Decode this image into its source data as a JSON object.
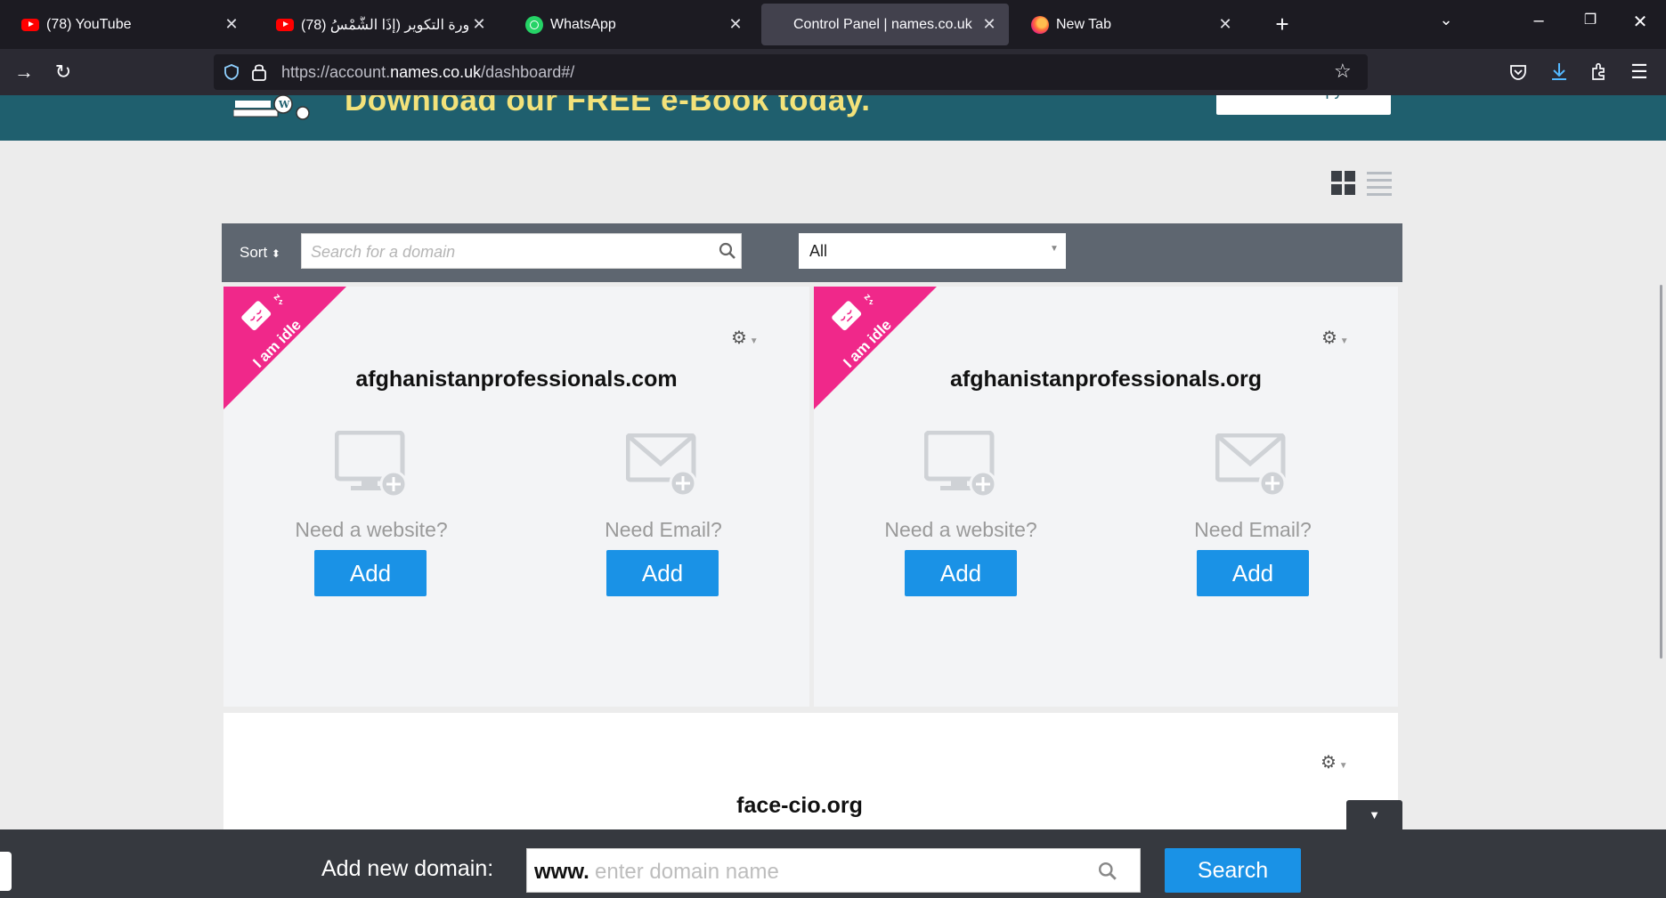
{
  "browser": {
    "tabs": [
      {
        "title": "(78) YouTube",
        "icon": "youtube-icon"
      },
      {
        "title": "(78) سورة التكوير (إِذَا الشَّمْسُ ﴾",
        "icon": "youtube-icon"
      },
      {
        "title": "WhatsApp",
        "icon": "whatsapp-icon"
      },
      {
        "title": "Control Panel | names.co.uk",
        "icon": "none",
        "active": true
      },
      {
        "title": "New Tab",
        "icon": "firefox-icon"
      }
    ],
    "url": "https://account.names.co.uk/dashboard#/",
    "url_parts": {
      "prefix": "https://account.",
      "domain": "names.co.uk",
      "suffix": "/dashboard#/"
    }
  },
  "banner": {
    "text": "Download our FREE e-Book today.",
    "button_label": "Get a copy"
  },
  "toolbar": {
    "sort_label": "Sort",
    "search_placeholder": "Search for a domain",
    "filter_value": "All"
  },
  "cards": [
    {
      "domain": "afghanistanprofessionals.com",
      "ribbon_text": "I am idle",
      "website_prompt": "Need a website?",
      "email_prompt": "Need Email?",
      "add_label": "Add"
    },
    {
      "domain": "afghanistanprofessionals.org",
      "ribbon_text": "I am idle",
      "website_prompt": "Need a website?",
      "email_prompt": "Need Email?",
      "add_label": "Add"
    },
    {
      "domain": "face-cio.org"
    }
  ],
  "bottom_bar": {
    "label": "Add new domain:",
    "www": "www.",
    "placeholder": "enter domain name",
    "search_label": "Search",
    "toggle": "▼"
  },
  "colors": {
    "accent": "#1a92e6",
    "ribbon": "#f0288a",
    "banner_bg": "#1f5f6e",
    "toolbar_bg": "#5e6670"
  }
}
